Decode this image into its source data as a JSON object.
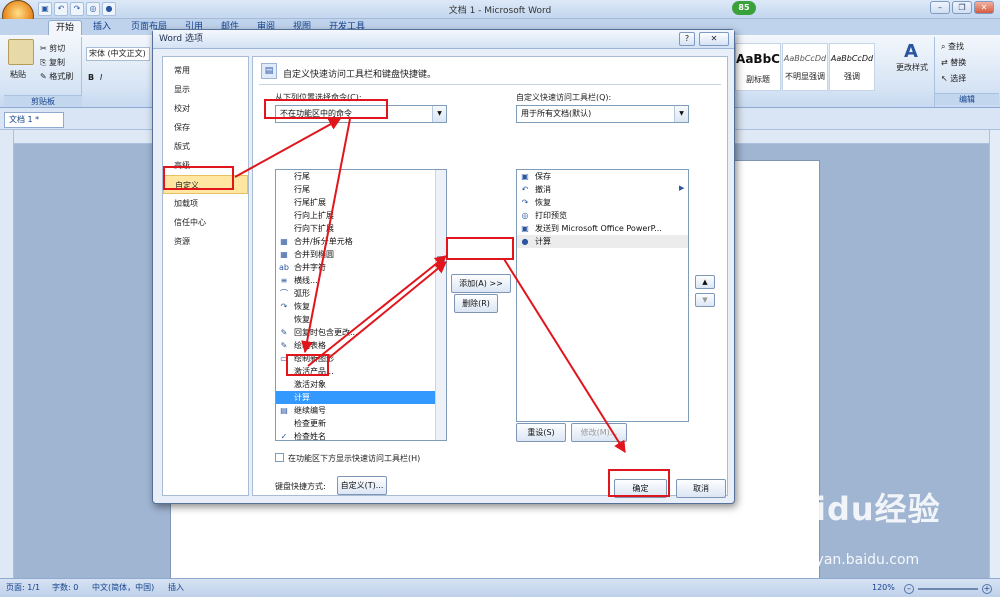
{
  "window": {
    "title": "文档 1 - Microsoft Word",
    "badge": "85"
  },
  "ribbon": {
    "tabs": [
      "开始",
      "插入",
      "页面布局",
      "引用",
      "邮件",
      "审阅",
      "视图",
      "开发工具"
    ],
    "clipboard": {
      "paste": "粘贴",
      "cut": "剪切",
      "copy": "复制",
      "format_painter": "格式刷",
      "group": "剪贴板"
    },
    "font": {
      "name": "宋体 (中文正文)"
    },
    "styles": [
      {
        "preview": "AaBbC",
        "name": "副标题"
      },
      {
        "preview": "AaBbCcDd",
        "name": "不明显强调"
      },
      {
        "preview": "AaBbCcDd",
        "name": "强调"
      }
    ],
    "change_styles": "更改样式",
    "editing": {
      "find": "查找",
      "replace": "替换",
      "select": "选择",
      "group": "编辑"
    }
  },
  "doc_tab": "文档 1 *",
  "statusbar": {
    "page": "页面: 1/1",
    "words": "字数: 0",
    "language": "中文(简体，中国)",
    "mode": "插入",
    "zoom": "120%"
  },
  "dialog": {
    "title": "Word 选项",
    "nav": [
      "常用",
      "显示",
      "校对",
      "保存",
      "版式",
      "高级",
      "自定义",
      "加载项",
      "信任中心",
      "资源"
    ],
    "selected_nav": 6,
    "heading": "自定义快速访问工具栏和键盘快捷键。",
    "choose_label": "从下列位置选择命令(C):",
    "choose_value": "不在功能区中的命令",
    "customize_label": "自定义快速访问工具栏(Q):",
    "customize_value": "用于所有文档(默认)",
    "commands": [
      {
        "icon": "",
        "label": "行尾"
      },
      {
        "icon": "",
        "label": "行尾"
      },
      {
        "icon": "",
        "label": "行尾扩展"
      },
      {
        "icon": "",
        "label": "行向上扩展"
      },
      {
        "icon": "",
        "label": "行向下扩展"
      },
      {
        "icon": "▦",
        "label": "合并/拆分单元格"
      },
      {
        "icon": "▦",
        "label": "合并到椭圆"
      },
      {
        "icon": "ab",
        "label": "合并字符"
      },
      {
        "icon": "≡",
        "label": "横线..."
      },
      {
        "icon": "⌒",
        "label": "弧形"
      },
      {
        "icon": "↷",
        "label": "恢复"
      },
      {
        "icon": "",
        "label": "恢复"
      },
      {
        "icon": "✎",
        "label": "回复时包含更改..."
      },
      {
        "icon": "✎",
        "label": "绘制表格"
      },
      {
        "icon": "▭",
        "label": "绘制新图形"
      },
      {
        "icon": "",
        "label": "激活产品..."
      },
      {
        "icon": "",
        "label": "激活对象"
      },
      {
        "icon": "",
        "label": "计算"
      },
      {
        "icon": "▤",
        "label": "继续编号"
      },
      {
        "icon": "",
        "label": "检查更新"
      },
      {
        "icon": "✓",
        "label": "检查姓名"
      }
    ],
    "selected_command": 17,
    "qat_items": [
      {
        "icon": "▣",
        "label": "保存"
      },
      {
        "icon": "↶",
        "label": "撤消"
      },
      {
        "icon": "↷",
        "label": "恢复"
      },
      {
        "icon": "◎",
        "label": "打印预览"
      },
      {
        "icon": "▣",
        "label": "发送到 Microsoft Office PowerP..."
      },
      {
        "icon": "●",
        "label": "计算"
      }
    ],
    "add_button": "添加(A) >>",
    "remove_button": "删除(R)",
    "reset_button": "重设(S)",
    "modify_button": "修改(M)...",
    "show_below_label": "在功能区下方显示快速访问工具栏(H)",
    "keyboard_label": "键盘快捷方式:",
    "customize_button": "自定义(T)...",
    "ok_button": "确定",
    "cancel_button": "取消"
  },
  "watermark": {
    "brand": "Baidu经验",
    "url": "jingyan.baidu.com"
  },
  "colors": {
    "annotation": "#e0161c",
    "selection": "#3399ff",
    "nav_selected": "#ffe7a2"
  }
}
